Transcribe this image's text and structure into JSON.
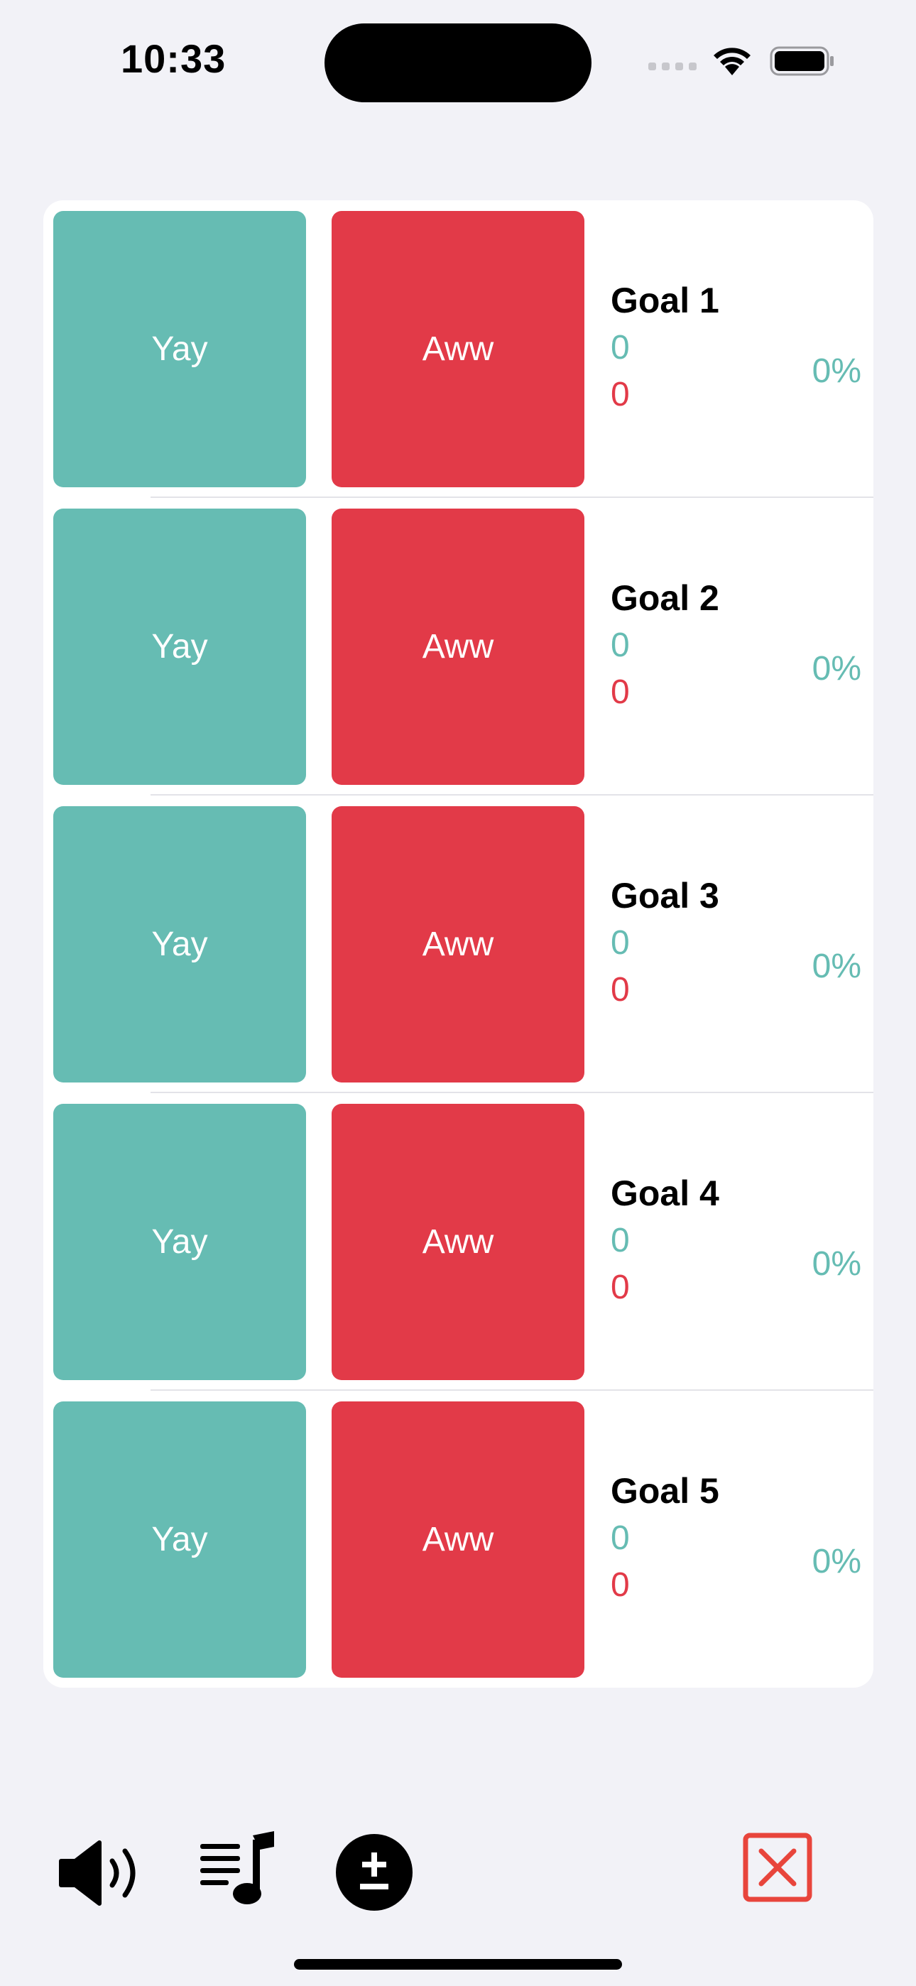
{
  "status_bar": {
    "time": "10:33"
  },
  "goals": [
    {
      "yay_label": "Yay",
      "aww_label": "Aww",
      "title": "Goal 1",
      "yay_count": "0",
      "aww_count": "0",
      "percent": "0%"
    },
    {
      "yay_label": "Yay",
      "aww_label": "Aww",
      "title": "Goal 2",
      "yay_count": "0",
      "aww_count": "0",
      "percent": "0%"
    },
    {
      "yay_label": "Yay",
      "aww_label": "Aww",
      "title": "Goal 3",
      "yay_count": "0",
      "aww_count": "0",
      "percent": "0%"
    },
    {
      "yay_label": "Yay",
      "aww_label": "Aww",
      "title": "Goal 4",
      "yay_count": "0",
      "aww_count": "0",
      "percent": "0%"
    },
    {
      "yay_label": "Yay",
      "aww_label": "Aww",
      "title": "Goal 5",
      "yay_count": "0",
      "aww_count": "0",
      "percent": "0%"
    }
  ],
  "toolbar": {
    "icons": [
      "speaker-volume-icon",
      "music-list-icon",
      "plus-minus-circle-icon",
      "close-box-icon"
    ]
  },
  "colors": {
    "yay": "#66BCB3",
    "aww": "#E23A48",
    "background": "#F2F2F7",
    "close_icon": "#E8453C"
  }
}
